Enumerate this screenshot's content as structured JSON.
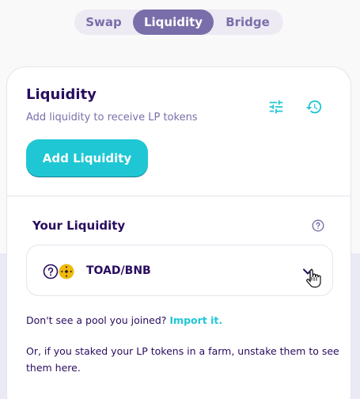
{
  "tabs": [
    {
      "label": "Swap",
      "active": false
    },
    {
      "label": "Liquidity",
      "active": true
    },
    {
      "label": "Bridge",
      "active": false
    }
  ],
  "card": {
    "title": "Liquidity",
    "subtitle": "Add liquidity to receive LP tokens",
    "settings_icon": "settings-sliders-icon",
    "history_icon": "history-icon",
    "add_button_label": "Add Liquidity"
  },
  "your_liquidity": {
    "label": "Your Liquidity",
    "help_icon": "question-circle-icon",
    "pools": [
      {
        "pair": "TOAD/BNB",
        "token0_icon": "unknown-token-icon",
        "token1_icon": "bnb-token-icon",
        "expanded": false
      }
    ]
  },
  "notes": {
    "missing_pool_text": "Don't see a pool you joined?",
    "import_link": "Import it.",
    "farm_text": "Or, if you staked your LP tokens in a farm, unstake them to see them here."
  },
  "colors": {
    "primary": "#1fc7d4",
    "secondary": "#7a6eaa",
    "text": "#280d5f",
    "bnb": "#f0b90b"
  }
}
